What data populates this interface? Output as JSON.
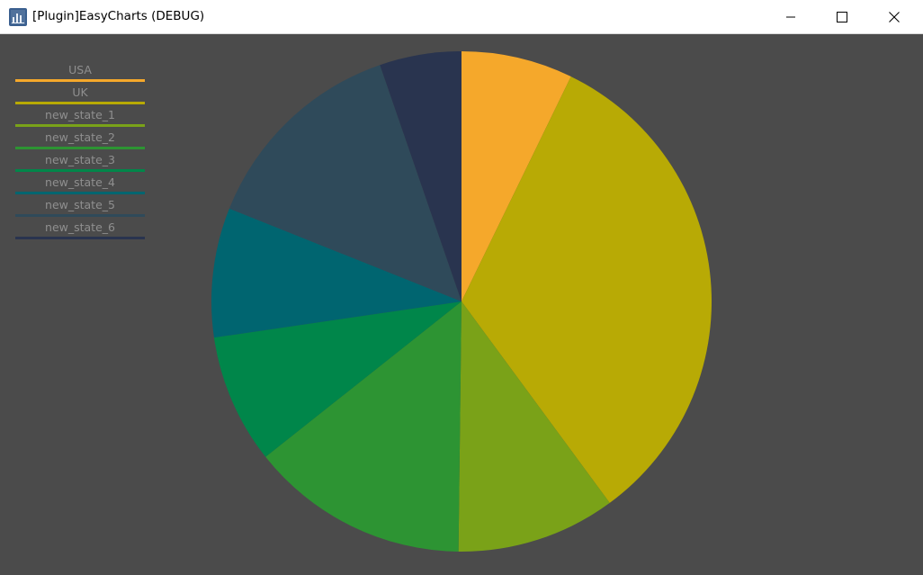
{
  "window": {
    "title": "[Plugin]EasyCharts (DEBUG)",
    "icon": "chart-app-icon",
    "controls": {
      "minimize": "minimize-icon",
      "maximize": "maximize-icon",
      "close": "close-icon"
    }
  },
  "background_color": "#4b4b4b",
  "chart_data": {
    "type": "pie",
    "title": "",
    "legend_position": "top-left",
    "start": "top, clockwise",
    "slices": [
      {
        "label": "USA",
        "value": 7.5,
        "color": "#f5a82b"
      },
      {
        "label": "UK",
        "value": 34.0,
        "color": "#b8aa05"
      },
      {
        "label": "new_state_1",
        "value": 10.7,
        "color": "#7aa218"
      },
      {
        "label": "new_state_2",
        "value": 14.7,
        "color": "#2d9433"
      },
      {
        "label": "new_state_3",
        "value": 8.7,
        "color": "#00864a"
      },
      {
        "label": "new_state_4",
        "value": 8.7,
        "color": "#006570"
      },
      {
        "label": "new_state_5",
        "value": 14.2,
        "color": "#2f4a5a"
      },
      {
        "label": "new_state_6",
        "value": 5.5,
        "color": "#29344f"
      }
    ]
  }
}
